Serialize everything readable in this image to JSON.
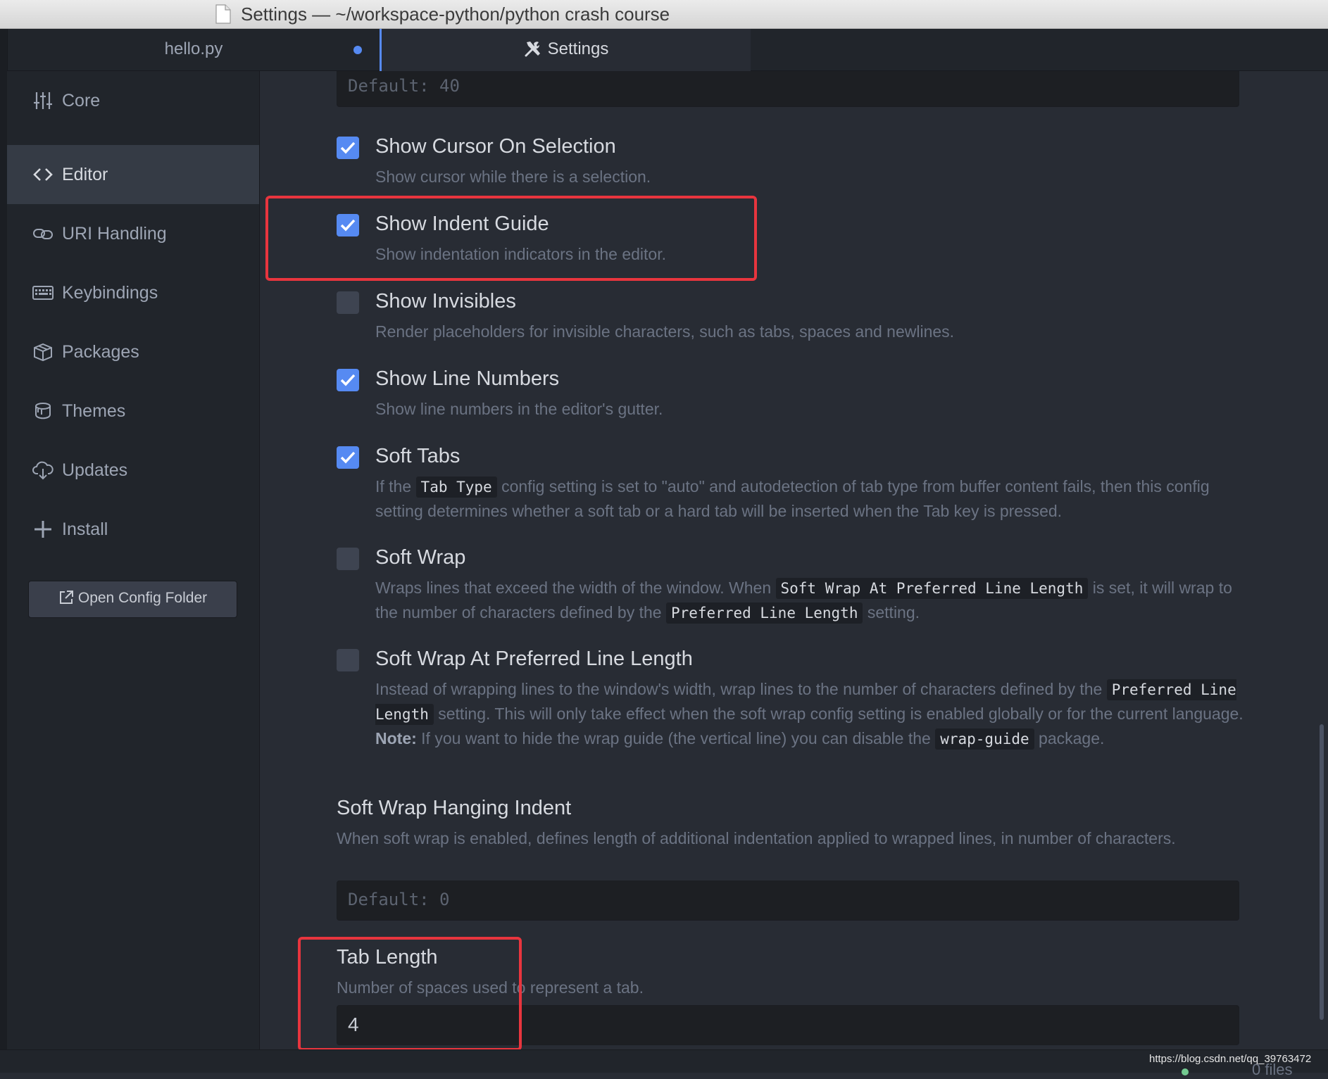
{
  "window": {
    "title": "Settings — ~/workspace-python/python crash course"
  },
  "tabs": [
    {
      "label": "hello.py",
      "modified": true
    },
    {
      "label": "Settings",
      "icon": "tools-icon"
    }
  ],
  "sidebar": {
    "items": [
      {
        "label": "Core",
        "icon": "sliders-icon"
      },
      {
        "label": "Editor",
        "icon": "code-icon",
        "active": true
      },
      {
        "label": "URI Handling",
        "icon": "link-icon"
      },
      {
        "label": "Keybindings",
        "icon": "keyboard-icon"
      },
      {
        "label": "Packages",
        "icon": "package-icon"
      },
      {
        "label": "Themes",
        "icon": "paintcan-icon"
      },
      {
        "label": "Updates",
        "icon": "cloud-download-icon"
      },
      {
        "label": "Install",
        "icon": "plus-icon"
      }
    ],
    "open_config_label": "Open Config Folder"
  },
  "settings": {
    "top_input_placeholder": "Default: 40",
    "show_cursor_on_selection": {
      "title": "Show Cursor On Selection",
      "desc": "Show cursor while there is a selection.",
      "checked": true
    },
    "show_indent_guide": {
      "title": "Show Indent Guide",
      "desc": "Show indentation indicators in the editor.",
      "checked": true
    },
    "show_invisibles": {
      "title": "Show Invisibles",
      "desc": "Render placeholders for invisible characters, such as tabs, spaces and newlines.",
      "checked": false
    },
    "show_line_numbers": {
      "title": "Show Line Numbers",
      "desc": "Show line numbers in the editor's gutter.",
      "checked": true
    },
    "soft_tabs": {
      "title": "Soft Tabs",
      "checked": true,
      "desc_1": "If the",
      "code_1": "Tab Type",
      "desc_2": "config setting is set to \"auto\" and autodetection of tab type from buffer content fails, then this config setting determines whether a soft tab or a hard tab will be inserted when the Tab key is pressed."
    },
    "soft_wrap": {
      "title": "Soft Wrap",
      "checked": false,
      "desc_1": "Wraps lines that exceed the width of the window. When",
      "code_1": "Soft Wrap At Preferred Line Length",
      "desc_2": "is set, it will wrap to the number of characters defined by the",
      "code_2": "Preferred Line Length",
      "desc_3": "setting."
    },
    "soft_wrap_at_preferred": {
      "title": "Soft Wrap At Preferred Line Length",
      "checked": false,
      "desc_1": "Instead of wrapping lines to the window's width, wrap lines to the number of characters defined by the",
      "code_1": "Preferred Line Length",
      "desc_2": "setting. This will only take effect when the soft wrap config setting is enabled globally or for the current language.",
      "note_label": "Note:",
      "desc_3": "If you want to hide the wrap guide (the vertical line) you can disable the",
      "code_2": "wrap-guide",
      "desc_4": "package."
    },
    "soft_wrap_hanging_indent": {
      "title": "Soft Wrap Hanging Indent",
      "desc": "When soft wrap is enabled, defines length of additional indentation applied to wrapped lines, in number of characters.",
      "placeholder": "Default: 0"
    },
    "tab_length": {
      "title": "Tab Length",
      "desc": "Number of spaces used to represent a tab.",
      "value": "4"
    }
  },
  "status_bar": {
    "url": "https://blog.csdn.net/qq_39763472",
    "files": "0 files"
  },
  "colors": {
    "accent": "#568af2",
    "highlight": "#e8353e",
    "background": "#282c34"
  }
}
